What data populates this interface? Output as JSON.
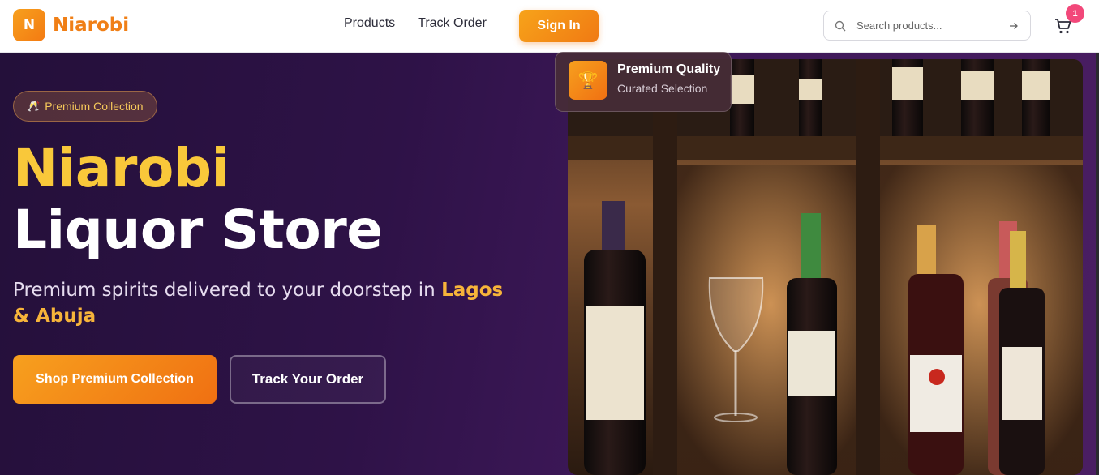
{
  "header": {
    "logo_letter": "N",
    "logo_text": "Niarobi",
    "nav": [
      "Products",
      "Track Order"
    ],
    "signin_label": "Sign In",
    "search_placeholder": "Search products...",
    "cart_count": "1"
  },
  "hero": {
    "pill_icon": "champagne-icon",
    "pill_label": "Premium Collection",
    "title_line1": "Niarobi",
    "title_line2": "Liquor Store",
    "subtitle_text": "Premium spirits delivered to your doorstep in ",
    "subtitle_highlight": "Lagos & Abuja",
    "primary_cta": "Shop Premium Collection",
    "secondary_cta": "Track Your Order"
  },
  "badge": {
    "icon": "trophy-icon",
    "title": "Premium Quality",
    "subtitle": "Curated Selection"
  },
  "colors": {
    "accent": "#f07f16",
    "gold": "#f9c83a",
    "hero_bg": "#2e1247",
    "cart_badge": "#f2487a"
  }
}
